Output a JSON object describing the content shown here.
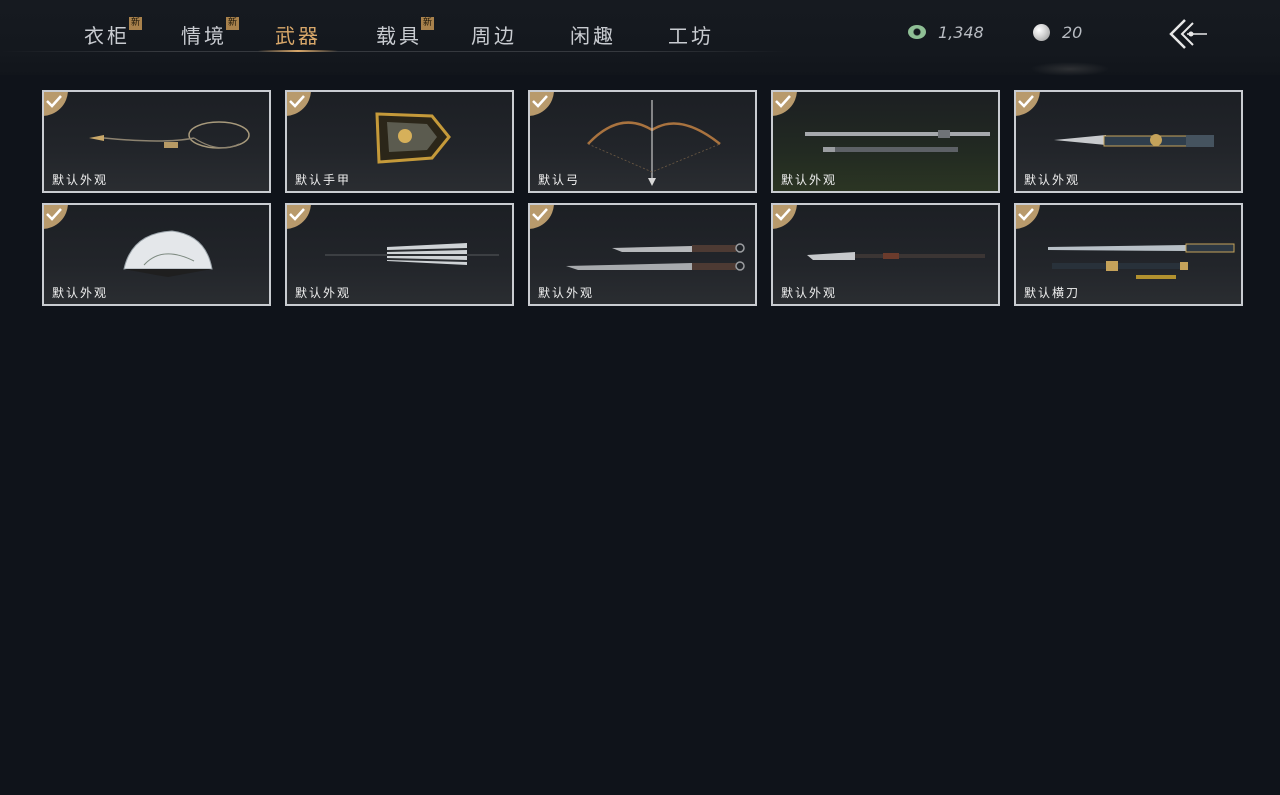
{
  "tabs": [
    {
      "label": "衣柜",
      "new": "新"
    },
    {
      "label": "情境",
      "new": "新"
    },
    {
      "label": "武器",
      "new": ""
    },
    {
      "label": "载具",
      "new": "新"
    },
    {
      "label": "周边",
      "new": ""
    },
    {
      "label": "闲趣",
      "new": ""
    },
    {
      "label": "工坊",
      "new": ""
    }
  ],
  "active_tab": "武器",
  "currency": {
    "jade": {
      "icon": "jade-coin-icon",
      "value": "1,348"
    },
    "pearl": {
      "icon": "pearl-icon",
      "value": "20"
    }
  },
  "colors": {
    "accent": "#d9a86a",
    "badge": "#a9824c",
    "background": "#0f131a",
    "card_border": "#c9ccd1"
  },
  "items": [
    {
      "label": "默认外观",
      "icon": "rope-dart-icon",
      "equipped": true
    },
    {
      "label": "默认手甲",
      "icon": "gauntlet-icon",
      "equipped": true
    },
    {
      "label": "默认弓",
      "icon": "bow-icon",
      "equipped": true
    },
    {
      "label": "默认外观",
      "icon": "spear-icon",
      "equipped": true
    },
    {
      "label": "默认外观",
      "icon": "halberd-icon",
      "equipped": true
    },
    {
      "label": "默认外观",
      "icon": "folding-fan-icon",
      "equipped": true
    },
    {
      "label": "默认外观",
      "icon": "umbrella-icon",
      "equipped": true
    },
    {
      "label": "默认外观",
      "icon": "dual-blades-icon",
      "equipped": true
    },
    {
      "label": "默认外观",
      "icon": "glaive-icon",
      "equipped": true
    },
    {
      "label": "默认横刀",
      "icon": "hengdao-sword-icon",
      "equipped": true
    }
  ]
}
